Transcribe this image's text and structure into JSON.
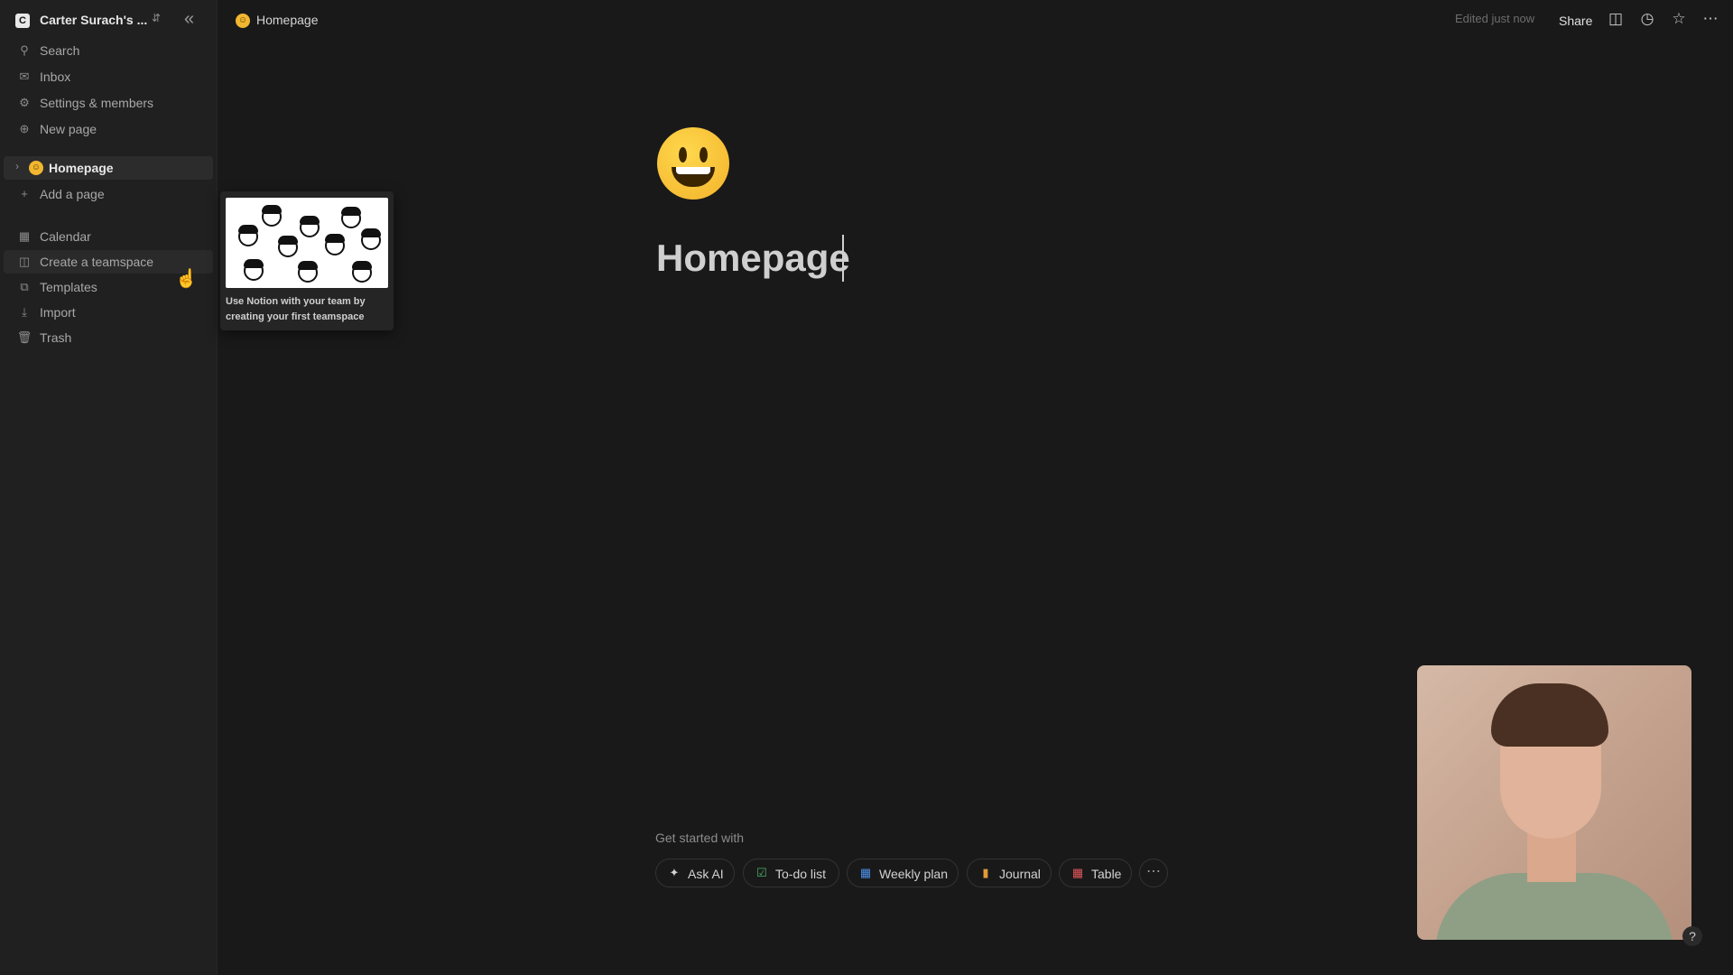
{
  "sidebar": {
    "workspace_name": "Carter Surach's ...",
    "logo_letter": "C",
    "top_items": [
      {
        "label": "Search",
        "icon": "search-icon"
      },
      {
        "label": "Inbox",
        "icon": "inbox-icon"
      },
      {
        "label": "Settings & members",
        "icon": "gear-icon"
      },
      {
        "label": "New page",
        "icon": "plus-circle-icon"
      }
    ],
    "pages": [
      {
        "label": "Homepage",
        "icon": "smiley-emoji"
      }
    ],
    "add_page_label": "Add a page",
    "bottom_items": [
      {
        "label": "Calendar",
        "icon": "calendar-icon"
      },
      {
        "label": "Create a teamspace",
        "icon": "teamspace-icon"
      },
      {
        "label": "Templates",
        "icon": "templates-icon"
      },
      {
        "label": "Import",
        "icon": "import-icon"
      },
      {
        "label": "Trash",
        "icon": "trash-icon"
      }
    ]
  },
  "tooltip": {
    "text": "Use Notion with your team by creating your first teamspace"
  },
  "topbar": {
    "breadcrumb": "Homepage",
    "edited_status": "Edited just now",
    "share_label": "Share",
    "icons": [
      "comment-icon",
      "history-icon",
      "star-icon",
      "more-icon"
    ]
  },
  "page": {
    "emoji": "smiley-face",
    "title": "Homepage"
  },
  "get_started": {
    "label": "Get started with",
    "chips": [
      {
        "label": "Ask AI",
        "icon": "sparkle-icon",
        "color": "#d2d2d2"
      },
      {
        "label": "To-do list",
        "icon": "checkbox-icon",
        "color": "#4caf6a"
      },
      {
        "label": "Weekly plan",
        "icon": "calendar-icon",
        "color": "#4a8fe8"
      },
      {
        "label": "Journal",
        "icon": "journal-icon",
        "color": "#e09a3a"
      },
      {
        "label": "Table",
        "icon": "table-icon",
        "color": "#e0565a"
      }
    ]
  },
  "help_label": "?",
  "colors": {
    "background": "#191919",
    "sidebar": "#202020",
    "accent_emoji": "#f2b630"
  }
}
